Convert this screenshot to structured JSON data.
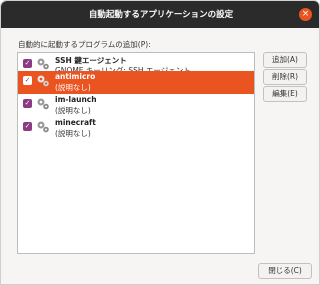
{
  "window": {
    "title": "自動起動するアプリケーションの設定",
    "close_glyph": "×"
  },
  "section_label": "自動的に起動するプログラムの追加(P):",
  "programs": [
    {
      "name": "SSH 鍵エージェント",
      "description": "GNOME キーリング: SSH エージェント",
      "checked": true,
      "selected": false
    },
    {
      "name": "antimicro",
      "description": "(説明なし)",
      "checked": true,
      "selected": true
    },
    {
      "name": "im-launch",
      "description": "(説明なし)",
      "checked": true,
      "selected": false
    },
    {
      "name": "minecraft",
      "description": "(説明なし)",
      "checked": true,
      "selected": false
    }
  ],
  "buttons": {
    "add": "追加(A)",
    "remove": "削除(R)",
    "edit": "編集(E)",
    "close": "閉じる(C)"
  },
  "colors": {
    "accent": "#e95420",
    "checkbox": "#8b3a83",
    "titlebar": "#2b2b2b"
  },
  "icons": [
    "close-icon",
    "checkmark-icon",
    "gears-icon"
  ]
}
